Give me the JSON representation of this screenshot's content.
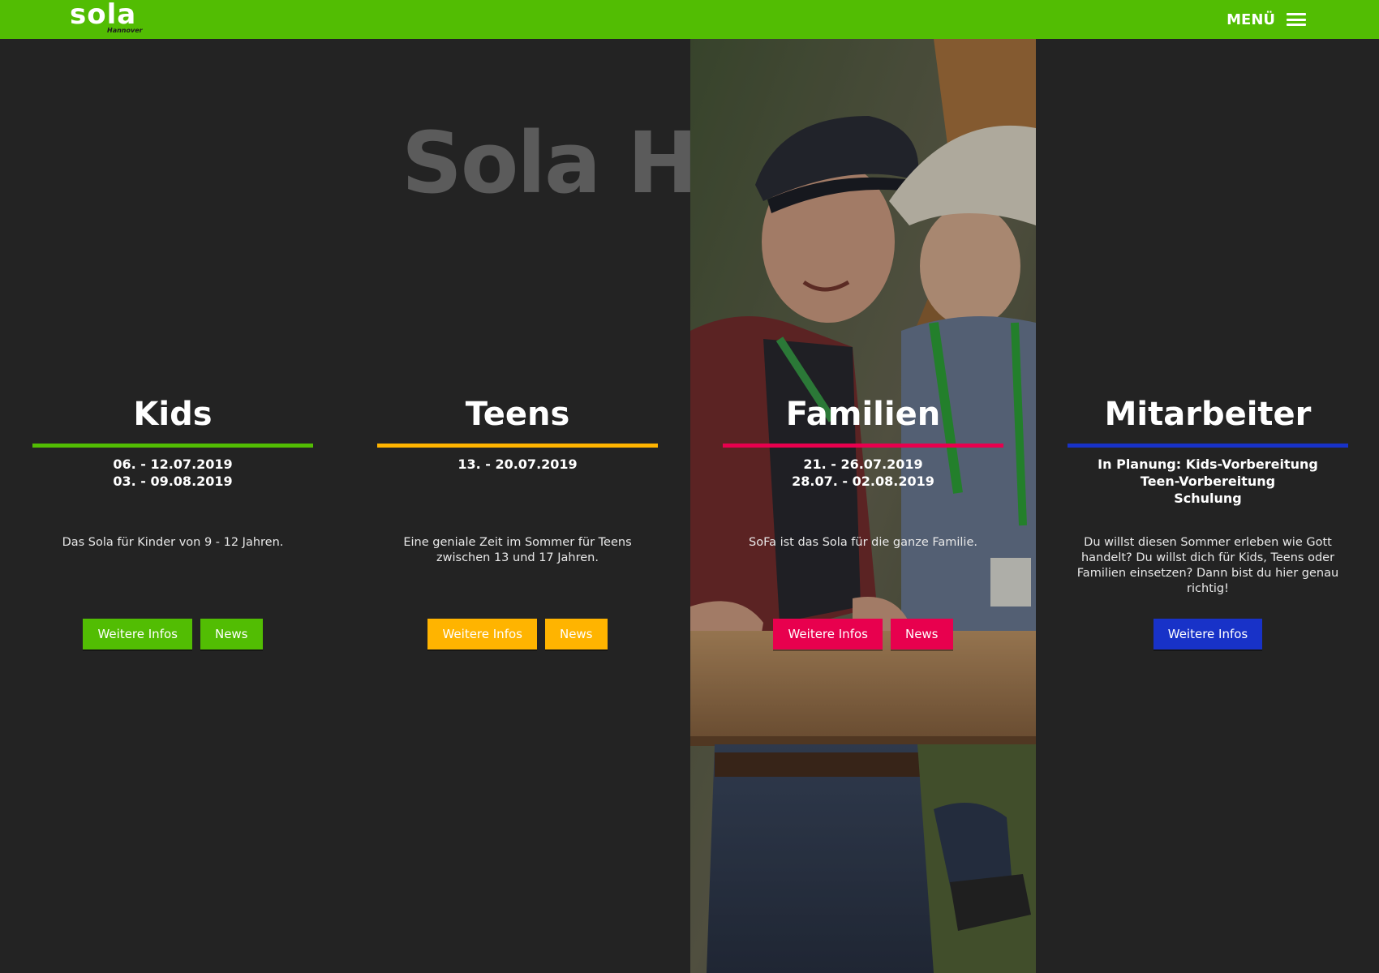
{
  "header": {
    "logo_text": "sola",
    "logo_subtext": "Hannover",
    "menu_label": "MENÜ",
    "bg_color": "#52bd03"
  },
  "hero": {
    "title": "Sola Hannover"
  },
  "photo": {
    "description_icon": "photo-man-and-child"
  },
  "columns": [
    {
      "id": "kids",
      "title": "Kids",
      "color": "#52bd03",
      "dates": [
        "06. - 12.07.2019",
        "03. - 09.08.2019"
      ],
      "description": "Das Sola für Kinder von 9 - 12 Jahren.",
      "buttons": [
        "Weitere Infos",
        "News"
      ]
    },
    {
      "id": "teens",
      "title": "Teens",
      "color": "#ffb400",
      "dates": [
        "13. - 20.07.2019"
      ],
      "description": "Eine geniale Zeit im Sommer für Teens zwischen 13 und 17 Jahren.",
      "buttons": [
        "Weitere Infos",
        "News"
      ]
    },
    {
      "id": "familien",
      "title": "Familien",
      "color": "#e8004e",
      "dates": [
        "21. - 26.07.2019",
        "28.07. - 02.08.2019"
      ],
      "description": "SoFa ist das Sola für die ganze Familie.",
      "buttons": [
        "Weitere Infos",
        "News"
      ]
    },
    {
      "id": "mitarbeiter",
      "title": "Mitarbeiter",
      "color": "#1832c8",
      "dates": [
        "In Planung: Kids-Vorbereitung",
        "Teen-Vorbereitung",
        "Schulung"
      ],
      "description": "Du willst diesen Sommer erleben wie Gott handelt? Du willst dich für Kids, Teens oder Familien einsetzen? Dann bist du hier genau richtig!",
      "buttons": [
        "Weitere Infos"
      ]
    }
  ]
}
